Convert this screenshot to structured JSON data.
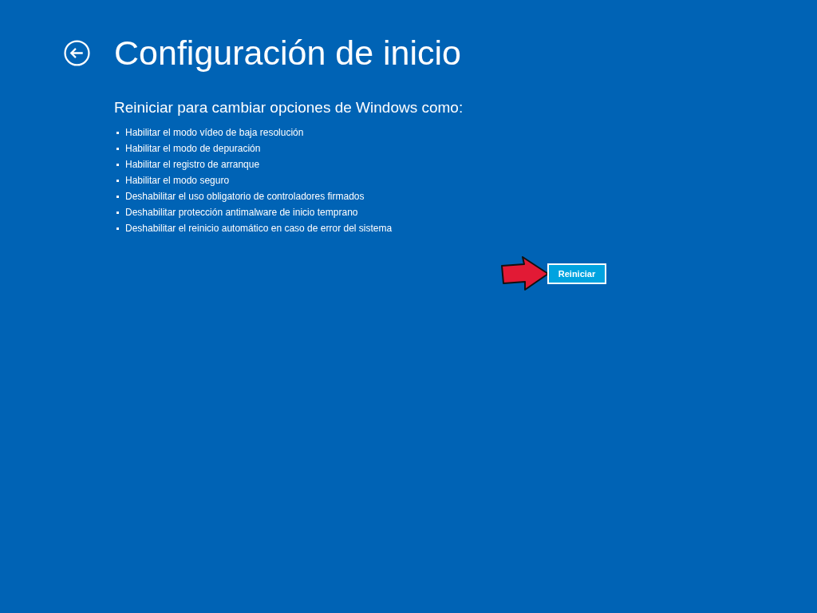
{
  "title": "Configuración de inicio",
  "subtitle": "Reiniciar para cambiar opciones de Windows como:",
  "options": [
    "Habilitar el modo vídeo de baja resolución",
    "Habilitar el modo de depuración",
    "Habilitar el registro de arranque",
    "Habilitar el modo seguro",
    "Deshabilitar el uso obligatorio de controladores firmados",
    "Deshabilitar protección antimalware de inicio temprano",
    "Deshabilitar el reinicio automático en caso de error del sistema"
  ],
  "button": "Reiniciar"
}
